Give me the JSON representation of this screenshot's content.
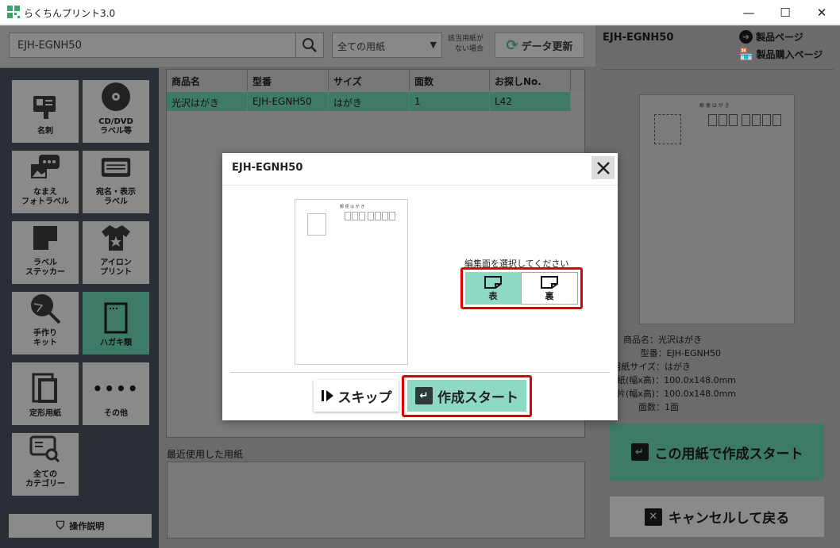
{
  "window": {
    "title": "らくちんプリント3.0",
    "minimize": "—",
    "maximize": "☐",
    "close": "✕"
  },
  "search": {
    "value": "EJH-EGNH50"
  },
  "filter": {
    "selected": "全ての用紙"
  },
  "note": {
    "line1": "該当用紙が",
    "line2": "ない場合"
  },
  "update_button": "データ更新",
  "sidebar": {
    "items": [
      {
        "label1": "名刺",
        "label2": "",
        "icon": "business-card-icon"
      },
      {
        "label1": "CD/DVD",
        "label2": "ラベル等",
        "icon": "disc-icon"
      },
      {
        "label1": "なまえ",
        "label2": "フォトラベル",
        "icon": "photo-label-icon"
      },
      {
        "label1": "宛名・表示",
        "label2": "ラベル",
        "icon": "address-label-icon"
      },
      {
        "label1": "ラベル",
        "label2": "ステッカー",
        "icon": "sticker-icon"
      },
      {
        "label1": "アイロン",
        "label2": "プリント",
        "icon": "tshirt-icon"
      },
      {
        "label1": "手作り",
        "label2": "キット",
        "icon": "fan-icon"
      },
      {
        "label1": "ハガキ類",
        "label2": "",
        "icon": "postcard-icon"
      },
      {
        "label1": "定形用紙",
        "label2": "",
        "icon": "paper-stack-icon"
      },
      {
        "label1": "その他",
        "label2": "",
        "icon": "more-icon"
      },
      {
        "label1": "全ての",
        "label2": "カテゴリー",
        "icon": "search-category-icon"
      }
    ],
    "help_button": "操作説明"
  },
  "table": {
    "headers": [
      "商品名",
      "型番",
      "サイズ",
      "面数",
      "お探しNo."
    ],
    "rows": [
      [
        "光沢はがき",
        "EJH-EGNH50",
        "はがき",
        "1",
        "L42"
      ]
    ]
  },
  "recent_label": "最近使用した用紙",
  "right_panel": {
    "title": "EJH-EGNH50",
    "product_page": "製品ページ",
    "purchase_page": "製品購入ページ",
    "info": [
      "商品名：光沢はがき",
      "型番：EJH-EGNH50",
      "用紙サイズ：はがき",
      "紙(幅x高)：100.0x148.0mm",
      "片(幅x高)：100.0x148.0mm",
      "面数：1面"
    ],
    "start_button": "この用紙で作成スタート",
    "cancel_button": "キャンセルして戻る"
  },
  "modal": {
    "title": "EJH-EGNH50",
    "postcard_heading": "郵 便 は が き",
    "face_prompt": "編集面を選択してください",
    "front_label": "表",
    "back_label": "裏",
    "skip_button": "スキップ",
    "start_button": "作成スタート"
  },
  "colors": {
    "accent": "#8ed8c4",
    "highlight": "#e00000",
    "sidebar": "#2a2e35"
  }
}
